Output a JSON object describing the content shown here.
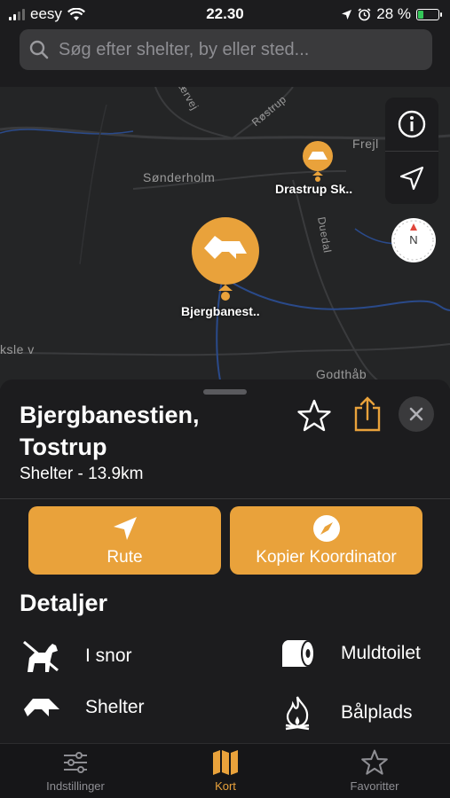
{
  "status": {
    "carrier": "eesy",
    "time": "22.30",
    "battery": "28 %",
    "battery_level": 0.28
  },
  "search": {
    "placeholder": "Søg efter shelter, by eller sted..."
  },
  "map": {
    "places": [
      "Sønderholm",
      "Frejl",
      "Godthåb",
      "ksle v",
      "Duedal",
      "Røstrup",
      "ærvej"
    ],
    "pins": [
      {
        "label": "Bjergbanest..",
        "selected": true
      },
      {
        "label": "Drastrup Sk..",
        "selected": false
      }
    ],
    "compass_label": "N"
  },
  "detail": {
    "title_line1": "Bjergbanestien,",
    "title_line2": "Tostrup",
    "subtitle": "Shelter - 13.9km",
    "actions": {
      "route": "Rute",
      "copy_coords": "Kopier Koordinator"
    },
    "section_title": "Detaljer",
    "features": [
      {
        "icon": "dog-leash-icon",
        "label": "I snor"
      },
      {
        "icon": "toilet-paper-icon",
        "label": "Muldtoilet"
      },
      {
        "icon": "shelter-icon",
        "label": "Shelter"
      },
      {
        "icon": "fire-icon",
        "label": "Bålplads"
      }
    ]
  },
  "tabs": [
    {
      "label": "Indstillinger",
      "active": false
    },
    {
      "label": "Kort",
      "active": true
    },
    {
      "label": "Favoritter",
      "active": false
    }
  ],
  "colors": {
    "accent": "#e9a23b",
    "background": "#1c1c1e",
    "map": "#242526"
  }
}
